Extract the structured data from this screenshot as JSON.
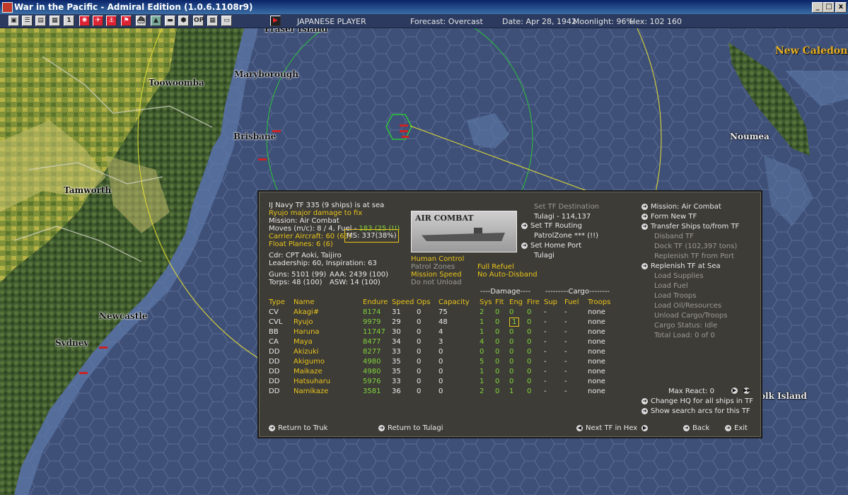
{
  "window": {
    "title": "War in the Pacific - Admiral Edition (1.0.6.1108r9)",
    "min": "_",
    "max": "□",
    "close": "x"
  },
  "toolbar": {
    "buttons": [
      "▣",
      "☰",
      "▤",
      "▦",
      "1",
      "✺",
      "✈",
      "⚓",
      "⚑",
      "⛴",
      "▲",
      "▬",
      "⬢",
      "OP",
      "▦",
      "▭",
      "▶"
    ],
    "player": "JAPANESE PLAYER",
    "forecast": "Forecast: Overcast",
    "date": "Date: Apr 28, 1942",
    "moonlight": "Moonlight: 96%",
    "hex": "Hex: 102 160"
  },
  "map": {
    "labels": {
      "fraser": "Fraser Island",
      "maryborough": "Maryborough",
      "toowoomba": "Toowoomba",
      "brisbane": "Brisbane",
      "tamworth": "Tamworth",
      "newcastle": "Newcastle",
      "sydney": "Sydney",
      "new_caledonia": "New Caledonia",
      "noumea": "Noumea",
      "norfolk": "olk Island"
    }
  },
  "panel": {
    "header": "IJ Navy TF 335 (9 ships) is at sea",
    "damage_note": "Ryujo major damage to fix",
    "mission": "Mission: Air Combat",
    "moves_prefix": "Moves (m/c): 8 / 4, Fuel - ",
    "fuel_value": "183 (25 (!!)",
    "carrier_aircraft": "Carrier Aircraft: 60 (63)",
    "ms": "MS: 337(38%)",
    "float_planes": "Float Planes: 6 (6)",
    "commander": "Cdr: CPT Aoki, Taijiro",
    "leadership": "Leadership: 60, Inspiration: 63",
    "guns": "Guns: 5101 (99)",
    "aaa": "AAA: 2439 (100)",
    "torps": "Torps: 48 (100)",
    "asw": "ASW: 14 (100)",
    "mission_image_label": "AIR COMBAT",
    "human_control": "Human Control",
    "patrol_zones": "Patrol Zones",
    "mission_speed": "Mission Speed",
    "do_not_unload": "Do not Unload",
    "full_refuel": "Full Refuel",
    "no_auto_disband": "No Auto-Disband",
    "set_tf_destination": "Set TF Destination",
    "destination": "Tulagi - 114,137",
    "set_tf_routing": "Set TF Routing",
    "patrol_zone": "PatrolZone *** (!!)",
    "set_home_port": "Set Home Port",
    "home_port": "Tulagi",
    "right_menu": {
      "mission": "Mission: Air Combat",
      "form_new": "Form New TF",
      "transfer": "Transfer Ships to/from TF",
      "disband": "Disband TF",
      "dock": "Dock TF (102,397 tons)",
      "replenish_port": "Replenish TF from Port",
      "replenish_sea": "Replenish TF at Sea",
      "load_supplies": "Load Supplies",
      "load_fuel": "Load Fuel",
      "load_troops": "Load Troops",
      "load_oil": "Load Oil/Resources",
      "unload": "Unload Cargo/Troops",
      "cargo_status": "Cargo Status: Idle",
      "total_load": "Total Load: 0 of 0",
      "max_react": "Max React: 0",
      "change_hq": "Change HQ for all ships in TF",
      "search_arcs": "Show search arcs for this TF"
    },
    "group_damage": "----Damage----",
    "group_cargo": "---------Cargo--------",
    "columns": [
      "Type",
      "Name",
      "Endure",
      "Speed",
      "Ops",
      "Capacity",
      "Sys",
      "Flt",
      "Eng",
      "Fire",
      "Sup",
      "Fuel",
      "Troops"
    ],
    "ships": [
      [
        "CV",
        "Akagi#",
        "8174",
        "31",
        "0",
        "75",
        "2",
        "0",
        "0",
        "0",
        "-",
        "-",
        "none"
      ],
      [
        "CVL",
        "Ryujo",
        "9979",
        "29",
        "0",
        "48",
        "1",
        "0",
        "1",
        "0",
        "-",
        "-",
        "none"
      ],
      [
        "BB",
        "Haruna",
        "11747",
        "30",
        "0",
        "4",
        "1",
        "0",
        "0",
        "0",
        "-",
        "-",
        "none"
      ],
      [
        "CA",
        "Maya",
        "8477",
        "34",
        "0",
        "3",
        "4",
        "0",
        "0",
        "0",
        "-",
        "-",
        "none"
      ],
      [
        "DD",
        "Akizuki",
        "8277",
        "33",
        "0",
        "0",
        "0",
        "0",
        "0",
        "0",
        "-",
        "-",
        "none"
      ],
      [
        "DD",
        "Akigumo",
        "4980",
        "35",
        "0",
        "0",
        "5",
        "0",
        "0",
        "0",
        "-",
        "-",
        "none"
      ],
      [
        "DD",
        "Maikaze",
        "4980",
        "35",
        "0",
        "0",
        "1",
        "0",
        "0",
        "0",
        "-",
        "-",
        "none"
      ],
      [
        "DD",
        "Hatsuharu",
        "5976",
        "33",
        "0",
        "0",
        "1",
        "0",
        "0",
        "0",
        "-",
        "-",
        "none"
      ],
      [
        "DD",
        "Namikaze",
        "3581",
        "36",
        "0",
        "0",
        "2",
        "0",
        "1",
        "0",
        "-",
        "-",
        "none"
      ]
    ],
    "footer": {
      "return_truk": "Return to Truk",
      "return_tulagi": "Return to Tulagi",
      "next_tf": "Next TF in Hex",
      "back": "Back",
      "exit": "Exit"
    }
  }
}
